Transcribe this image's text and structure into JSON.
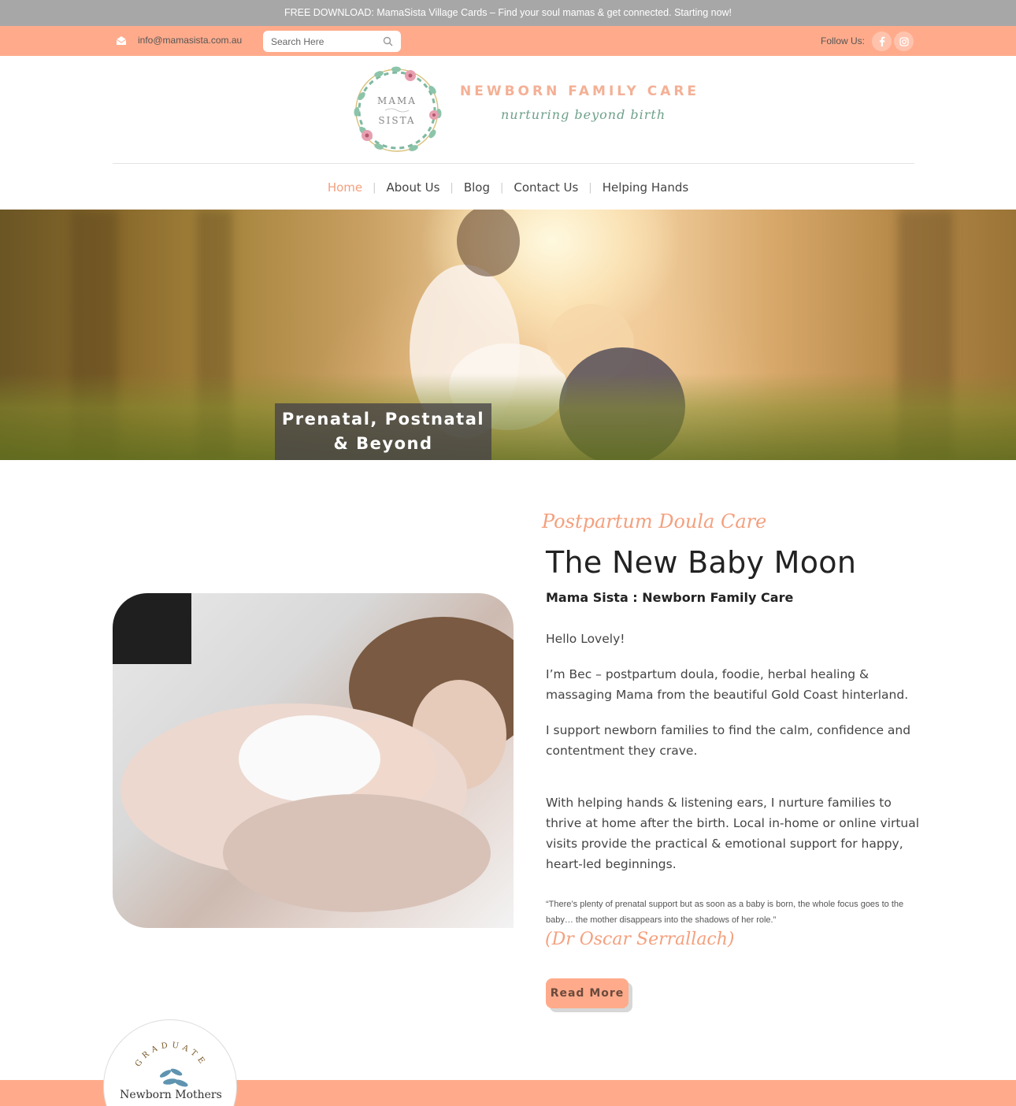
{
  "announcement": {
    "text": "FREE DOWNLOAD: MamaSista Village Cards – Find your soul mamas & get connected. Starting now!"
  },
  "topbar": {
    "email": "info@mamasista.com.au",
    "search_placeholder": "Search Here",
    "follow_label": "Follow Us:",
    "socials": [
      "facebook-icon",
      "instagram-icon"
    ]
  },
  "brand": {
    "logo_line1": "MAMA",
    "logo_line2": "SISTA",
    "title": "NEWBORN FAMILY CARE",
    "tagline": "nurturing beyond birth"
  },
  "nav": {
    "items": [
      {
        "label": "Home",
        "active": true
      },
      {
        "label": "About Us",
        "active": false
      },
      {
        "label": "Blog",
        "active": false
      },
      {
        "label": "Contact Us",
        "active": false
      },
      {
        "label": "Helping Hands",
        "active": false
      }
    ]
  },
  "hero": {
    "caption_line1": "Prenatal, Postnatal",
    "caption_line2": "& Beyond"
  },
  "intro": {
    "script_title": "Postpartum Doula Care",
    "headline": "The New Baby Moon",
    "subheading": "Mama Sista : Newborn Family Care",
    "paragraphs": [
      "Hello Lovely!",
      "I’m Bec – postpartum doula, foodie, herbal healing & massaging Mama from the beautiful Gold Coast hinterland.",
      "I support newborn families to find the calm, confidence and contentment they crave.",
      "With helping hands & listening ears, I nurture families to thrive at home after the birth. Local in-home or online virtual visits provide the practical & emotional support for happy, heart-led beginnings."
    ],
    "quote": "“There’s plenty of prenatal support but as soon as a baby is born, the whole focus goes to the baby… the mother disappears into the shadows of her role.”",
    "quote_author": "(Dr Oscar Serrallach)",
    "read_more": "Read More"
  },
  "badge": {
    "arc_text": "GRADUATE",
    "name": "Newborn Mothers"
  },
  "colors": {
    "accent": "#ffab8b",
    "accent_text": "#f4a07e",
    "green": "#6fa08a",
    "announce_bg": "#a7a7a7"
  }
}
